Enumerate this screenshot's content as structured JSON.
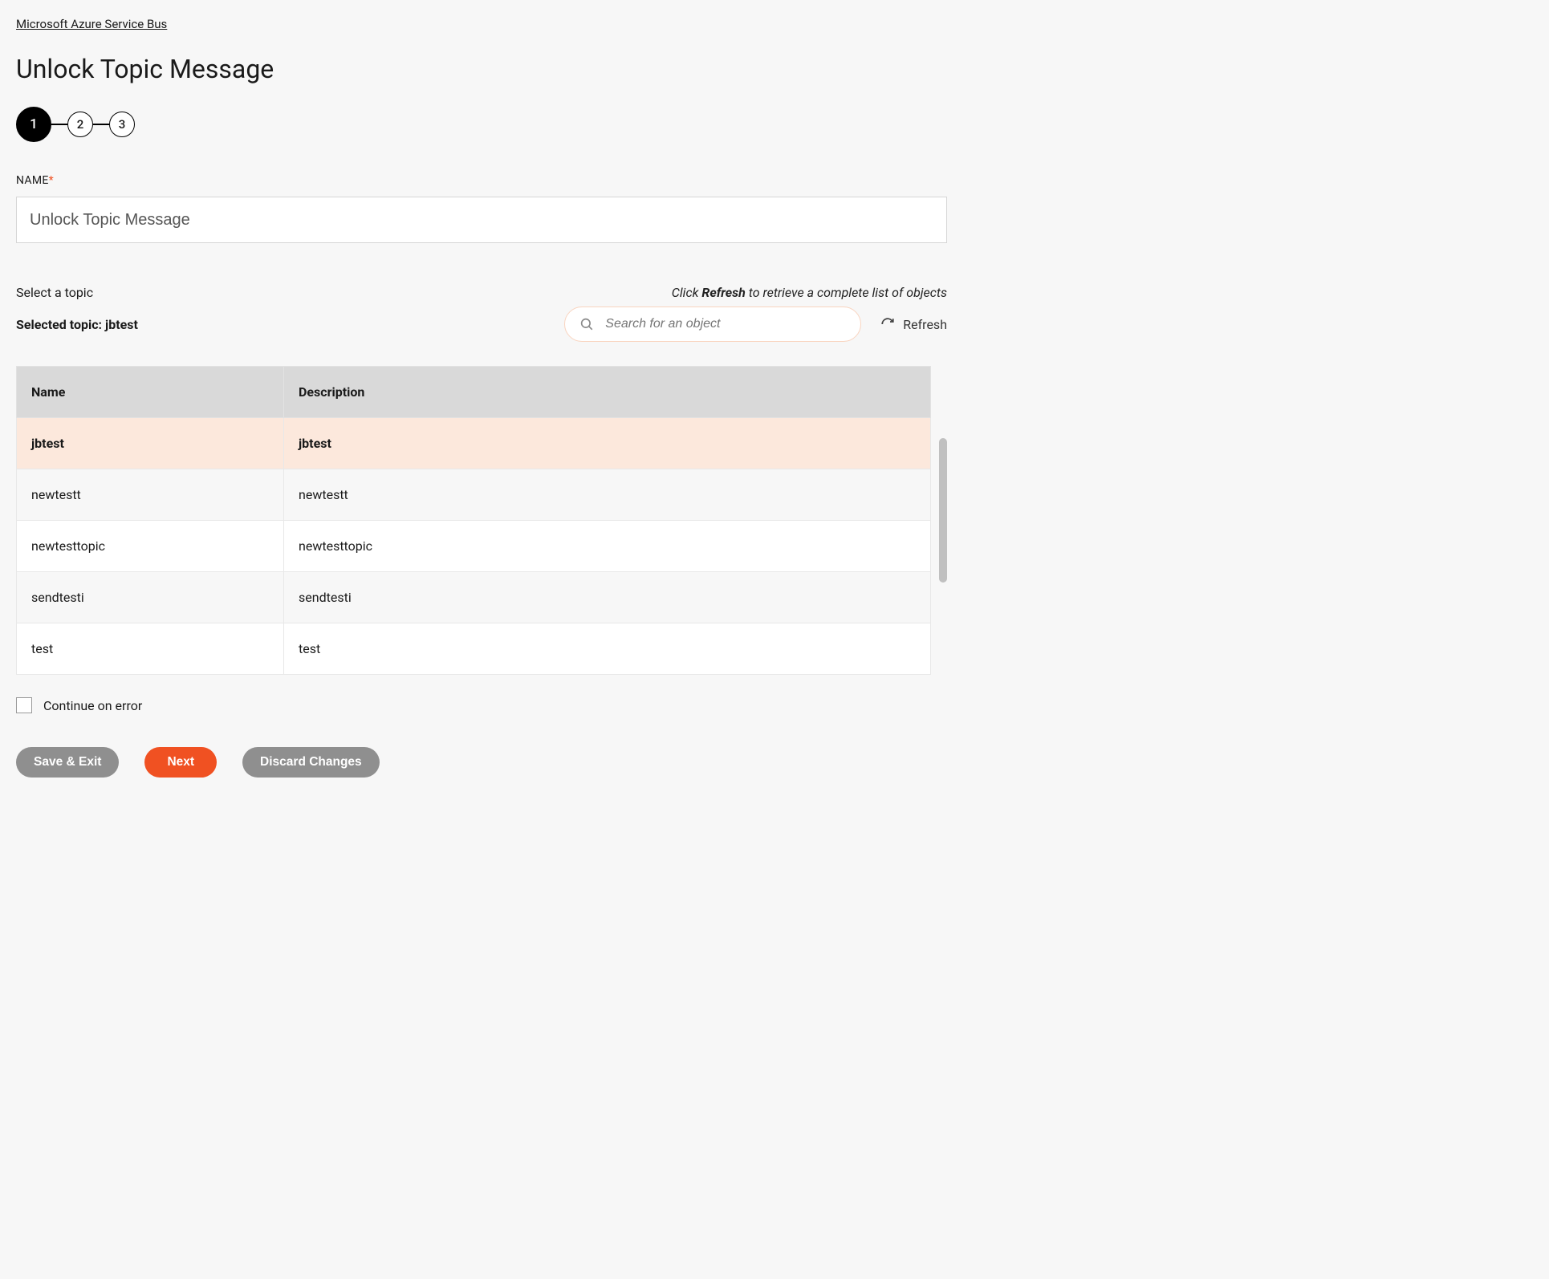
{
  "breadcrumb": "Microsoft Azure Service Bus",
  "page_title": "Unlock Topic Message",
  "stepper": {
    "steps": [
      "1",
      "2",
      "3"
    ],
    "active_index": 0
  },
  "name_field": {
    "label": "NAME",
    "required_marker": "*",
    "value": "Unlock Topic Message"
  },
  "topic_section": {
    "select_label": "Select a topic",
    "hint_prefix": "Click ",
    "hint_bold": "Refresh",
    "hint_suffix": " to retrieve a complete list of objects",
    "selected_prefix": "Selected topic: ",
    "selected_value": "jbtest",
    "search_placeholder": "Search for an object",
    "refresh_label": "Refresh"
  },
  "table": {
    "headers": {
      "name": "Name",
      "description": "Description"
    },
    "rows": [
      {
        "name": "jbtest",
        "description": "jbtest",
        "selected": true
      },
      {
        "name": "newtestt",
        "description": "newtestt",
        "selected": false
      },
      {
        "name": "newtesttopic",
        "description": "newtesttopic",
        "selected": false
      },
      {
        "name": "sendtesti",
        "description": "sendtesti",
        "selected": false
      },
      {
        "name": "test",
        "description": "test",
        "selected": false
      }
    ]
  },
  "continue_on_error_label": "Continue on error",
  "buttons": {
    "save_exit": "Save & Exit",
    "next": "Next",
    "discard": "Discard Changes"
  }
}
